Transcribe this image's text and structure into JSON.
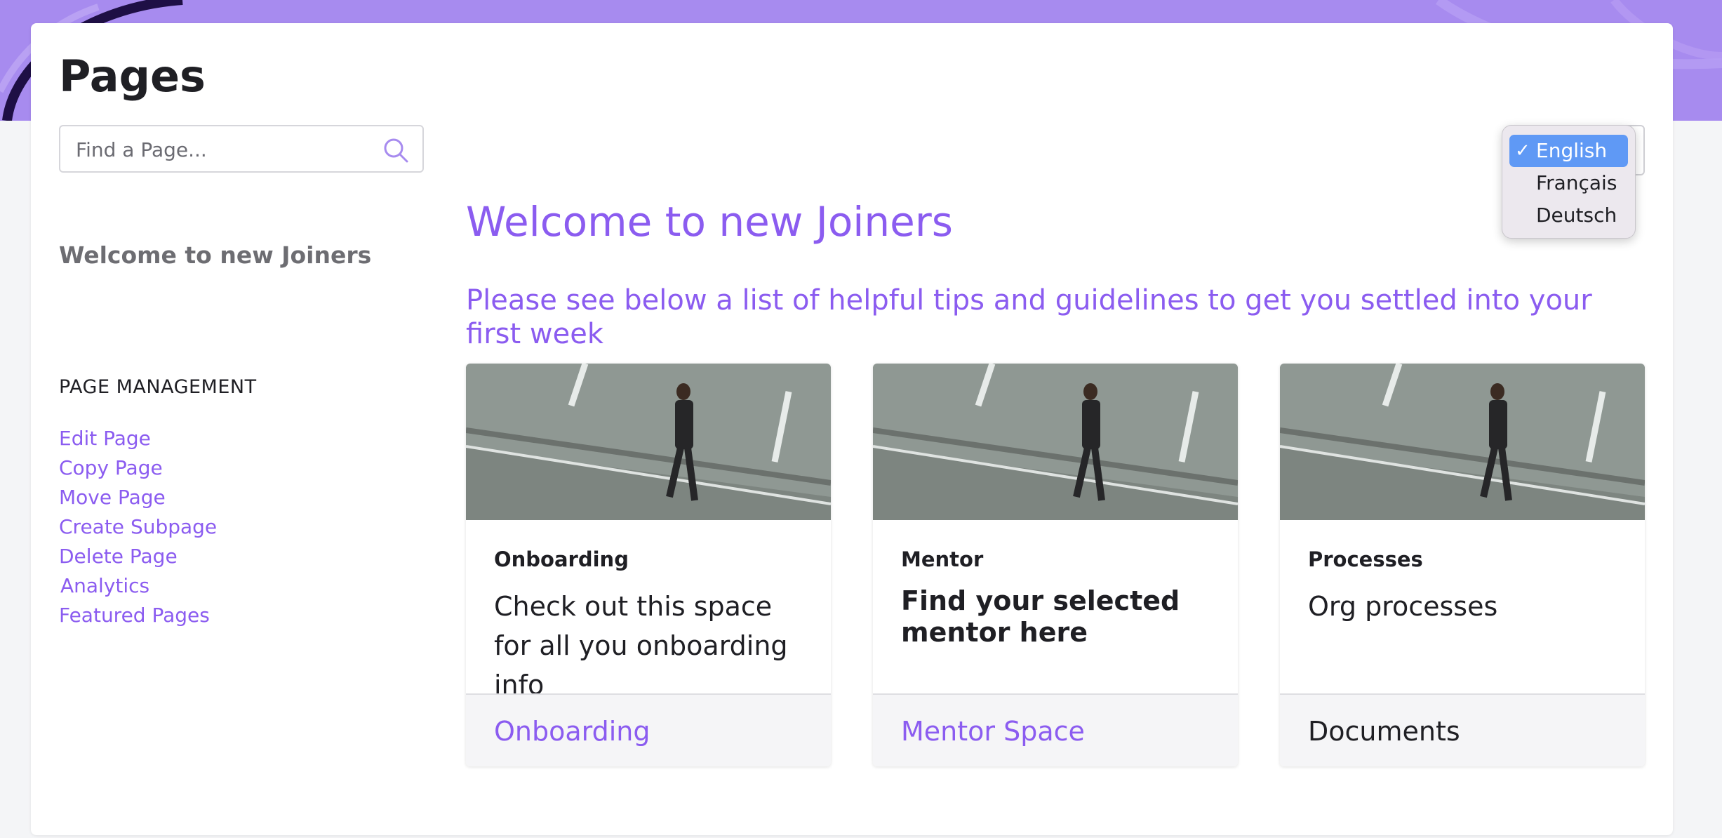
{
  "header": {
    "title": "Pages",
    "banner_color": "#a78bef"
  },
  "search": {
    "placeholder": "Find a Page...",
    "icon": "search-icon"
  },
  "sidebar": {
    "current_page": "Welcome to new Joiners",
    "management_header": "PAGE MANAGEMENT",
    "links": [
      {
        "label": "Edit Page"
      },
      {
        "label": "Copy Page"
      },
      {
        "label": "Move Page"
      },
      {
        "label": "Create Subpage"
      },
      {
        "label": "Delete Page"
      },
      {
        "label": "Analytics"
      },
      {
        "label": "Featured Pages"
      }
    ]
  },
  "main": {
    "title": "Welcome to new Joiners",
    "subtitle": "Please see below a list of helpful tips and guidelines to get you settled into your first week",
    "accent_color": "#8b5cf0",
    "cards": [
      {
        "label": "Onboarding",
        "text": "Check out this space for all you onboarding info",
        "link": "Onboarding"
      },
      {
        "label": "Mentor",
        "text": "Find your selected mentor here",
        "link": "Mentor Space"
      },
      {
        "label": "Processes",
        "text": "Org processes",
        "link": "Documents"
      }
    ]
  },
  "language": {
    "selected": "English",
    "options": [
      "English",
      "Français",
      "Deutsch"
    ],
    "selected_color": "#5f99f5"
  }
}
